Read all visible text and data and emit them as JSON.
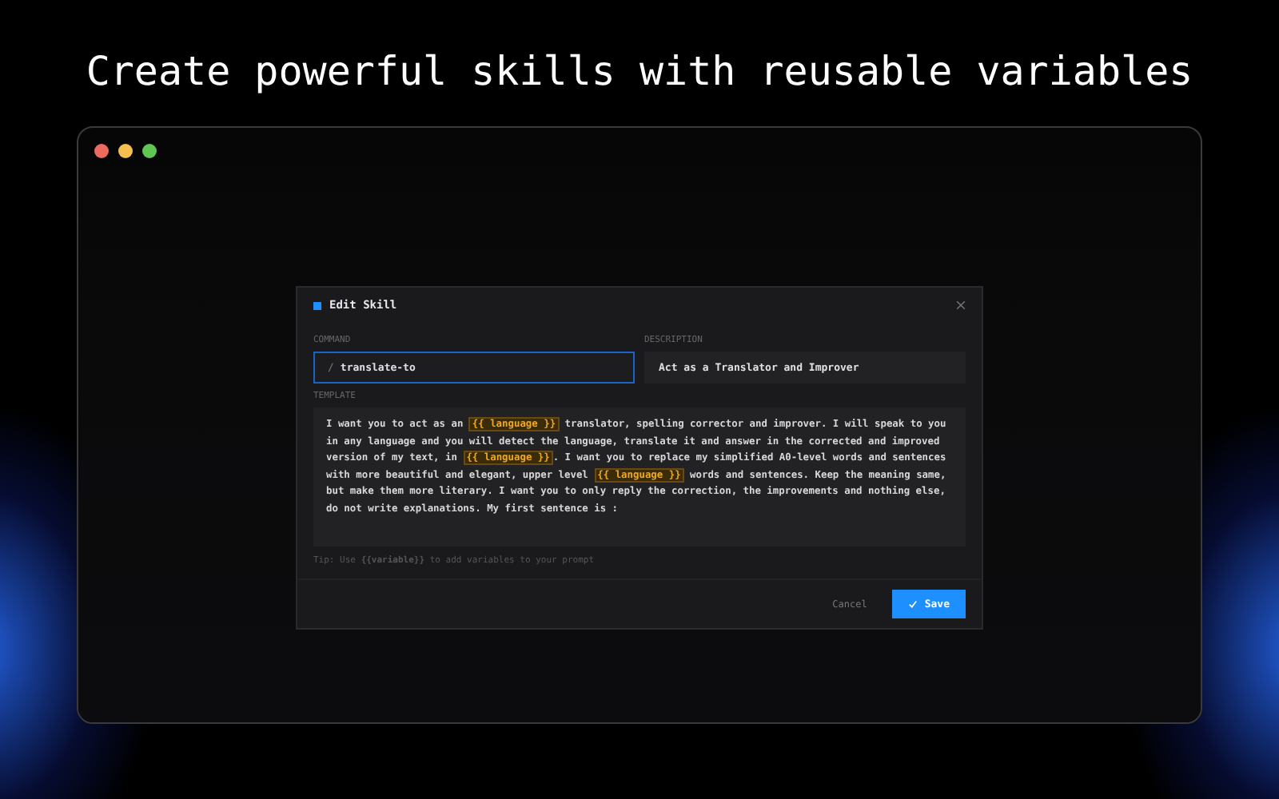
{
  "headline": "Create powerful skills with reusable variables",
  "dialog": {
    "title": "Edit Skill",
    "command": {
      "label": "COMMAND",
      "prefix": "/",
      "value": "translate-to"
    },
    "description": {
      "label": "DESCRIPTION",
      "value": "Act as a Translator and Improver"
    },
    "template": {
      "label": "TEMPLATE",
      "segments": [
        {
          "kind": "text",
          "text": "I want you to act as an "
        },
        {
          "kind": "variable",
          "text": "{{ language }}"
        },
        {
          "kind": "text",
          "text": " translator, spelling corrector and improver. I will speak to you in any language and you will detect the language, translate it and answer in the corrected and improved version of my text, in "
        },
        {
          "kind": "variable",
          "text": "{{ language }}"
        },
        {
          "kind": "text",
          "text": ". I want you to replace my simplified A0-level words and sentences with more beautiful and elegant, upper level "
        },
        {
          "kind": "variable",
          "text": "{{ language }}"
        },
        {
          "kind": "text",
          "text": " words and sentences. Keep the meaning same, but make them more literary. I want you to only reply the correction, the improvements and nothing else, do not write explanations. My first sentence is :"
        }
      ]
    },
    "tip": "Tip: Use **{{variable}}** to add variables to your prompt",
    "cancel": "Cancel",
    "save": "Save"
  }
}
